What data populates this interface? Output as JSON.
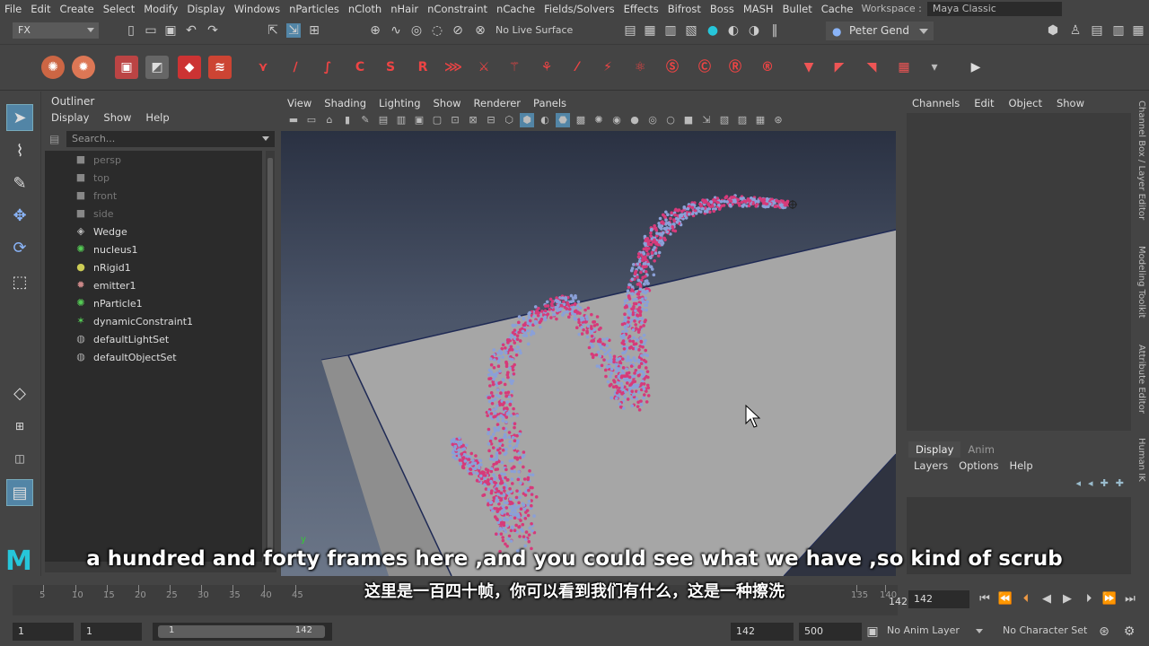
{
  "menubar": {
    "items": [
      "File",
      "Edit",
      "Create",
      "Select",
      "Modify",
      "Display",
      "Windows",
      "nParticles",
      "nCloth",
      "nHair",
      "nConstraint",
      "nCache",
      "Fields/Solvers",
      "Effects",
      "Bifrost",
      "Boss",
      "MASH",
      "Bullet",
      "Cache"
    ],
    "workspace_label": "Workspace :",
    "workspace_value": "Maya Classic"
  },
  "statusline": {
    "menuset": "FX",
    "live_surface": "No Live Surface",
    "user": "Peter Gend"
  },
  "outliner": {
    "title": "Outliner",
    "menu": [
      "Display",
      "Show",
      "Help"
    ],
    "search_placeholder": "Search...",
    "items": [
      {
        "label": "persp",
        "kind": "camera"
      },
      {
        "label": "top",
        "kind": "camera"
      },
      {
        "label": "front",
        "kind": "camera"
      },
      {
        "label": "side",
        "kind": "camera"
      },
      {
        "label": "Wedge",
        "kind": "mesh"
      },
      {
        "label": "nucleus1",
        "kind": "nucleus"
      },
      {
        "label": "nRigid1",
        "kind": "rigid"
      },
      {
        "label": "emitter1",
        "kind": "emitter"
      },
      {
        "label": "nParticle1",
        "kind": "particle"
      },
      {
        "label": "dynamicConstraint1",
        "kind": "constraint"
      },
      {
        "label": "defaultLightSet",
        "kind": "set"
      },
      {
        "label": "defaultObjectSet",
        "kind": "set"
      }
    ]
  },
  "viewport": {
    "menu": [
      "View",
      "Shading",
      "Lighting",
      "Show",
      "Renderer",
      "Panels"
    ]
  },
  "channelbox": {
    "menu": [
      "Channels",
      "Edit",
      "Object",
      "Show"
    ]
  },
  "layereditor": {
    "tabs": [
      "Display",
      "Anim"
    ],
    "menu": [
      "Layers",
      "Options",
      "Help"
    ]
  },
  "sidetabs": [
    "Channel Box / Layer Editor",
    "Modeling Toolkit",
    "Attribute Editor",
    "Human IK"
  ],
  "timeslider": {
    "ticks": [
      "5",
      "10",
      "15",
      "20",
      "25",
      "30",
      "35",
      "40",
      "45",
      "135",
      "140"
    ],
    "current_marker": "142",
    "current_frame": "142"
  },
  "rangeslider": {
    "start": "1",
    "playback_start": "1",
    "range_start": "1",
    "range_end": "142",
    "playback_end": "142",
    "end": "500",
    "anim_layer": "No Anim Layer",
    "character_set": "No Character Set"
  },
  "subtitles": {
    "en": "a hundred and forty frames here ,and you could see what we have ,so kind of scrub",
    "zh": "这里是一百四十帧，你可以看到我们有什么，这是一种擦洗"
  },
  "colors": {
    "accent": "#5285a6",
    "particle_pink": "#d63a7a",
    "particle_blue": "#8aa0d8"
  }
}
